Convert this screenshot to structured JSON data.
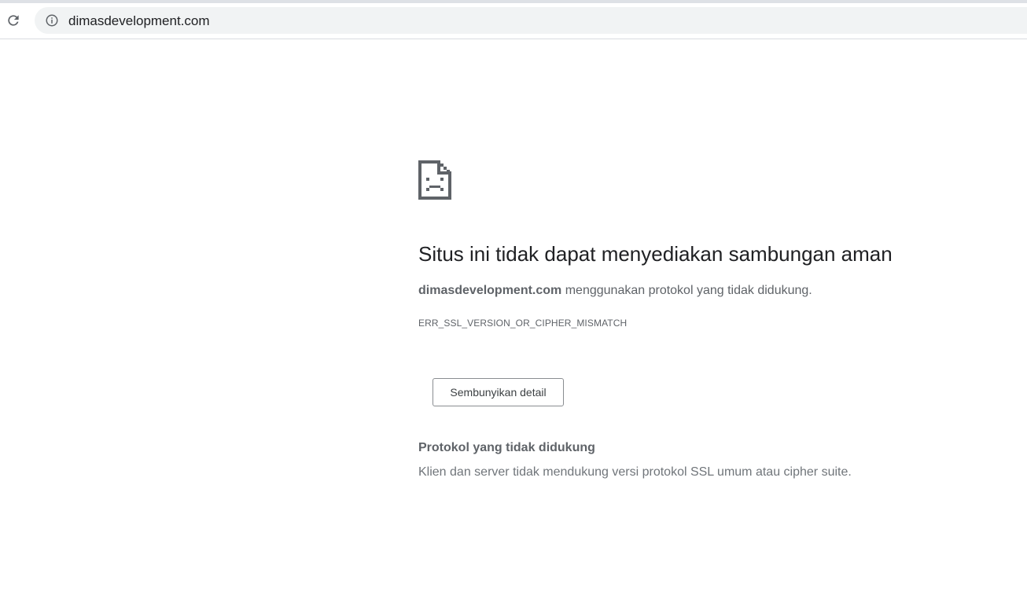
{
  "browser": {
    "url": "dimasdevelopment.com",
    "reload_icon": "reload-icon",
    "info_icon": "info-icon"
  },
  "error_page": {
    "icon": "sad-document-icon",
    "heading": "Situs ini tidak dapat menyediakan sambungan aman",
    "domain": "dimasdevelopment.com",
    "message_suffix": " menggunakan protokol yang tidak didukung.",
    "error_code": "ERR_SSL_VERSION_OR_CIPHER_MISMATCH",
    "details_button_label": "Sembunyikan detail",
    "details_heading": "Protokol yang tidak didukung",
    "details_text": "Klien dan server tidak mendukung versi protokol SSL umum atau cipher suite."
  },
  "colors": {
    "heading": "#202124",
    "body_text": "#5f6368",
    "omnibox_bg": "#f1f3f4"
  }
}
